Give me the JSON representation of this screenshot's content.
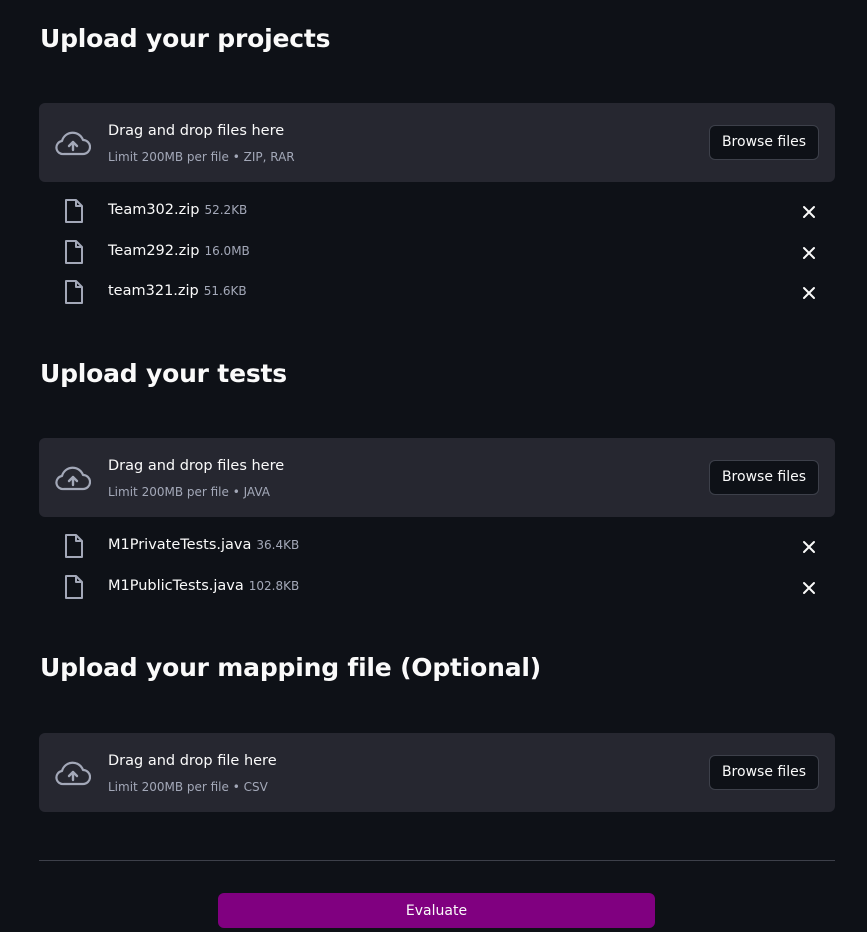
{
  "sections": [
    {
      "title": "Upload your projects",
      "dropzone": {
        "title": "Drag and drop files here",
        "limit": "Limit 200MB per file • ZIP, RAR",
        "browse_label": "Browse files"
      },
      "files": [
        {
          "name": "Team302.zip",
          "size": "52.2KB"
        },
        {
          "name": "Team292.zip",
          "size": "16.0MB"
        },
        {
          "name": "team321.zip",
          "size": "51.6KB"
        }
      ]
    },
    {
      "title": "Upload your tests",
      "dropzone": {
        "title": "Drag and drop files here",
        "limit": "Limit 200MB per file • JAVA",
        "browse_label": "Browse files"
      },
      "files": [
        {
          "name": "M1PrivateTests.java",
          "size": "36.4KB"
        },
        {
          "name": "M1PublicTests.java",
          "size": "102.8KB"
        }
      ]
    },
    {
      "title": "Upload your mapping file (Optional)",
      "dropzone": {
        "title": "Drag and drop file here",
        "limit": "Limit 200MB per file • CSV",
        "browse_label": "Browse files"
      },
      "files": []
    }
  ],
  "evaluate_label": "Evaluate",
  "colors": {
    "background": "#0e1117",
    "dropzone": "#262730",
    "accent_button": "#800080",
    "muted_text": "#a3a8b8"
  },
  "icons": {
    "dropzone": "cloud-upload-icon",
    "file": "document-icon",
    "remove": "close-icon"
  }
}
